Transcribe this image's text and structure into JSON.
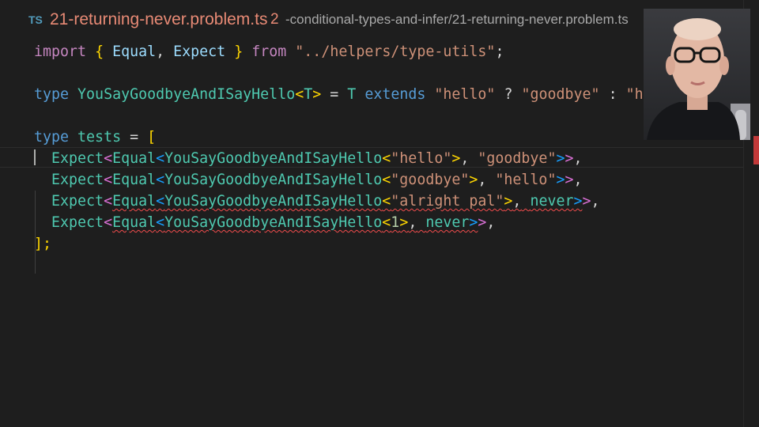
{
  "tab": {
    "language_badge": "TS",
    "filename": "21-returning-never.problem.ts",
    "error_count": "2",
    "path": "-conditional-types-and-infer/21-returning-never.problem.ts"
  },
  "code": {
    "line1": {
      "import_kw": "import",
      "open_brace": "{",
      "equal": "Equal",
      "comma": ",",
      "expect": "Expect",
      "close_brace": "}",
      "from_kw": "from",
      "module_path": "\"../helpers/type-utils\"",
      "semicolon": ";"
    },
    "line3": {
      "type_kw": "type",
      "name": "YouSayGoodbyeAndISayHello",
      "lt": "<",
      "param": "T",
      "gt": ">",
      "eq": "=",
      "t_ref": "T",
      "extends_kw": "extends",
      "hello": "\"hello\"",
      "q": "?",
      "goodbye": "\"goodbye\"",
      "colon": ":",
      "hello_tail": "\"hello\";"
    },
    "line5": {
      "type_kw": "type",
      "name": "tests",
      "eq": "=",
      "open": "["
    },
    "tests": [
      {
        "expect": "Expect",
        "equal": "Equal",
        "fn": "YouSayGoodbyeAndISayHello",
        "arg": "\"hello\"",
        "sep": ",",
        "expected": "\"goodbye\"",
        "end": ","
      },
      {
        "expect": "Expect",
        "equal": "Equal",
        "fn": "YouSayGoodbyeAndISayHello",
        "arg": "\"goodbye\"",
        "sep": ",",
        "expected": "\"hello\"",
        "end": ","
      },
      {
        "expect": "Expect",
        "equal": "Equal",
        "fn": "YouSayGoodbyeAndISayHello",
        "arg": "\"alright pal\"",
        "sep": ",",
        "expected": "never",
        "end": ","
      },
      {
        "expect": "Expect",
        "equal": "Equal",
        "fn": "YouSayGoodbyeAndISayHello",
        "arg": "1",
        "sep": ",",
        "expected": "never",
        "end": ","
      }
    ],
    "close": "];"
  }
}
